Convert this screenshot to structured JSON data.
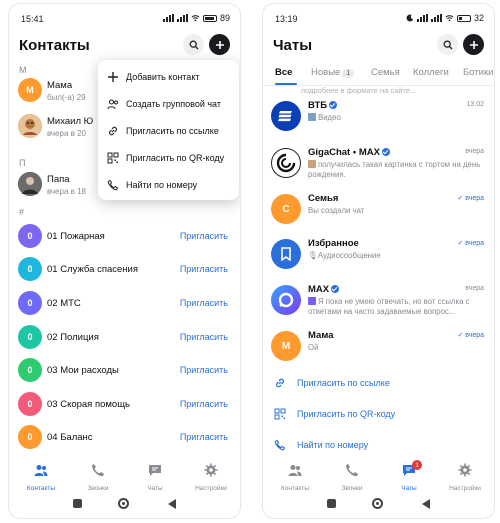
{
  "left": {
    "status": {
      "time": "15:41",
      "battery": "89"
    },
    "header": {
      "title": "Контакты"
    },
    "section_m": "М",
    "section_p": "П",
    "section_hash": "#",
    "contacts": [
      {
        "name": "Мама",
        "sub": "был(-а) 29",
        "avatar_letter": "М",
        "color": "#ff9a2e"
      },
      {
        "name": "Михаил Ю",
        "sub": "вчера в 20",
        "avatar_letter": "",
        "color": "#c98a4a"
      },
      {
        "name": "Папа",
        "sub": "вчера в 18",
        "avatar_letter": "",
        "color": "#444444"
      }
    ],
    "services": [
      {
        "name": "01 Пожарная",
        "letter": "0",
        "color": "#7b68ee",
        "invite": "Пригласить"
      },
      {
        "name": "01 Служба спасения",
        "letter": "0",
        "color": "#1fb6e0",
        "invite": "Пригласить"
      },
      {
        "name": "02 МТС",
        "letter": "0",
        "color": "#6f6af8",
        "invite": "Пригласить"
      },
      {
        "name": "02 Полиция",
        "letter": "0",
        "color": "#1fc6a6",
        "invite": "Пригласить"
      },
      {
        "name": "03 Мои расходы",
        "letter": "0",
        "color": "#2ecc71",
        "invite": "Пригласить"
      },
      {
        "name": "03 Скорая помощь",
        "letter": "0",
        "color": "#f25b7a",
        "invite": "Пригласить"
      },
      {
        "name": "04 Баланс",
        "letter": "0",
        "color": "#ff9a2e",
        "invite": "Пригласить"
      }
    ],
    "menu": [
      {
        "label": "Добавить контакт",
        "icon": "plus-icon"
      },
      {
        "label": "Создать групповой чат",
        "icon": "group-icon"
      },
      {
        "label": "Пригласить по ссылке",
        "icon": "link-icon"
      },
      {
        "label": "Пригласить по QR-коду",
        "icon": "qr-icon"
      },
      {
        "label": "Найти по номеру",
        "icon": "phone-icon"
      }
    ],
    "nav": [
      {
        "label": "Контакты",
        "icon": "contacts-icon",
        "active": true
      },
      {
        "label": "Звонки",
        "icon": "call-icon",
        "active": false
      },
      {
        "label": "Чаты",
        "icon": "chat-icon",
        "active": false
      },
      {
        "label": "Настройки",
        "icon": "settings-icon",
        "active": false
      }
    ]
  },
  "right": {
    "status": {
      "time": "13:19",
      "battery": "32"
    },
    "header": {
      "title": "Чаты"
    },
    "tabs": [
      {
        "label": "Все",
        "active": true
      },
      {
        "label": "Новые",
        "badge": "1"
      },
      {
        "label": "Семья"
      },
      {
        "label": "Коллеги"
      },
      {
        "label": "Ботики"
      }
    ],
    "faded_text": "подробнее в формате на сайте...",
    "chats": [
      {
        "name": "ВТБ",
        "verified": true,
        "time": "13:02",
        "msg": "Видео",
        "thumb_color": "#7aa0c8"
      },
      {
        "name": "GigaChat • MAX",
        "verified": true,
        "time": "вчера",
        "msg": "получилась такая картинка с тортом на день рождения.",
        "thumb_color": "#c9a27a"
      },
      {
        "name": "Семья",
        "verified": false,
        "time": "вчера",
        "msg": "Вы создали чат",
        "avatar_letter": "С",
        "read": true
      },
      {
        "name": "Избранное",
        "verified": false,
        "time": "вчера",
        "msg": "Аудиосообщение",
        "read": true
      },
      {
        "name": "MAX",
        "verified": true,
        "time": "вчера",
        "msg": "Я пока не умею отвечать, но вот ссылка с ответами на часто задаваемые вопрос...",
        "thumb_color": "#7b5cf0"
      },
      {
        "name": "Мама",
        "verified": false,
        "time": "вчера",
        "msg": "Ой",
        "avatar_letter": "М",
        "read": true
      }
    ],
    "actions": [
      {
        "label": "Пригласить по ссылке",
        "icon": "link-icon"
      },
      {
        "label": "Пригласить по QR-коду",
        "icon": "qr-icon"
      },
      {
        "label": "Найти по номеру",
        "icon": "phone-icon"
      }
    ],
    "nav": [
      {
        "label": "Контакты",
        "icon": "contacts-icon",
        "active": false
      },
      {
        "label": "Звонки",
        "icon": "call-icon",
        "active": false
      },
      {
        "label": "Чаты",
        "icon": "chat-icon",
        "active": true,
        "badge": "1"
      },
      {
        "label": "Настройки",
        "icon": "settings-icon",
        "active": false
      }
    ]
  }
}
